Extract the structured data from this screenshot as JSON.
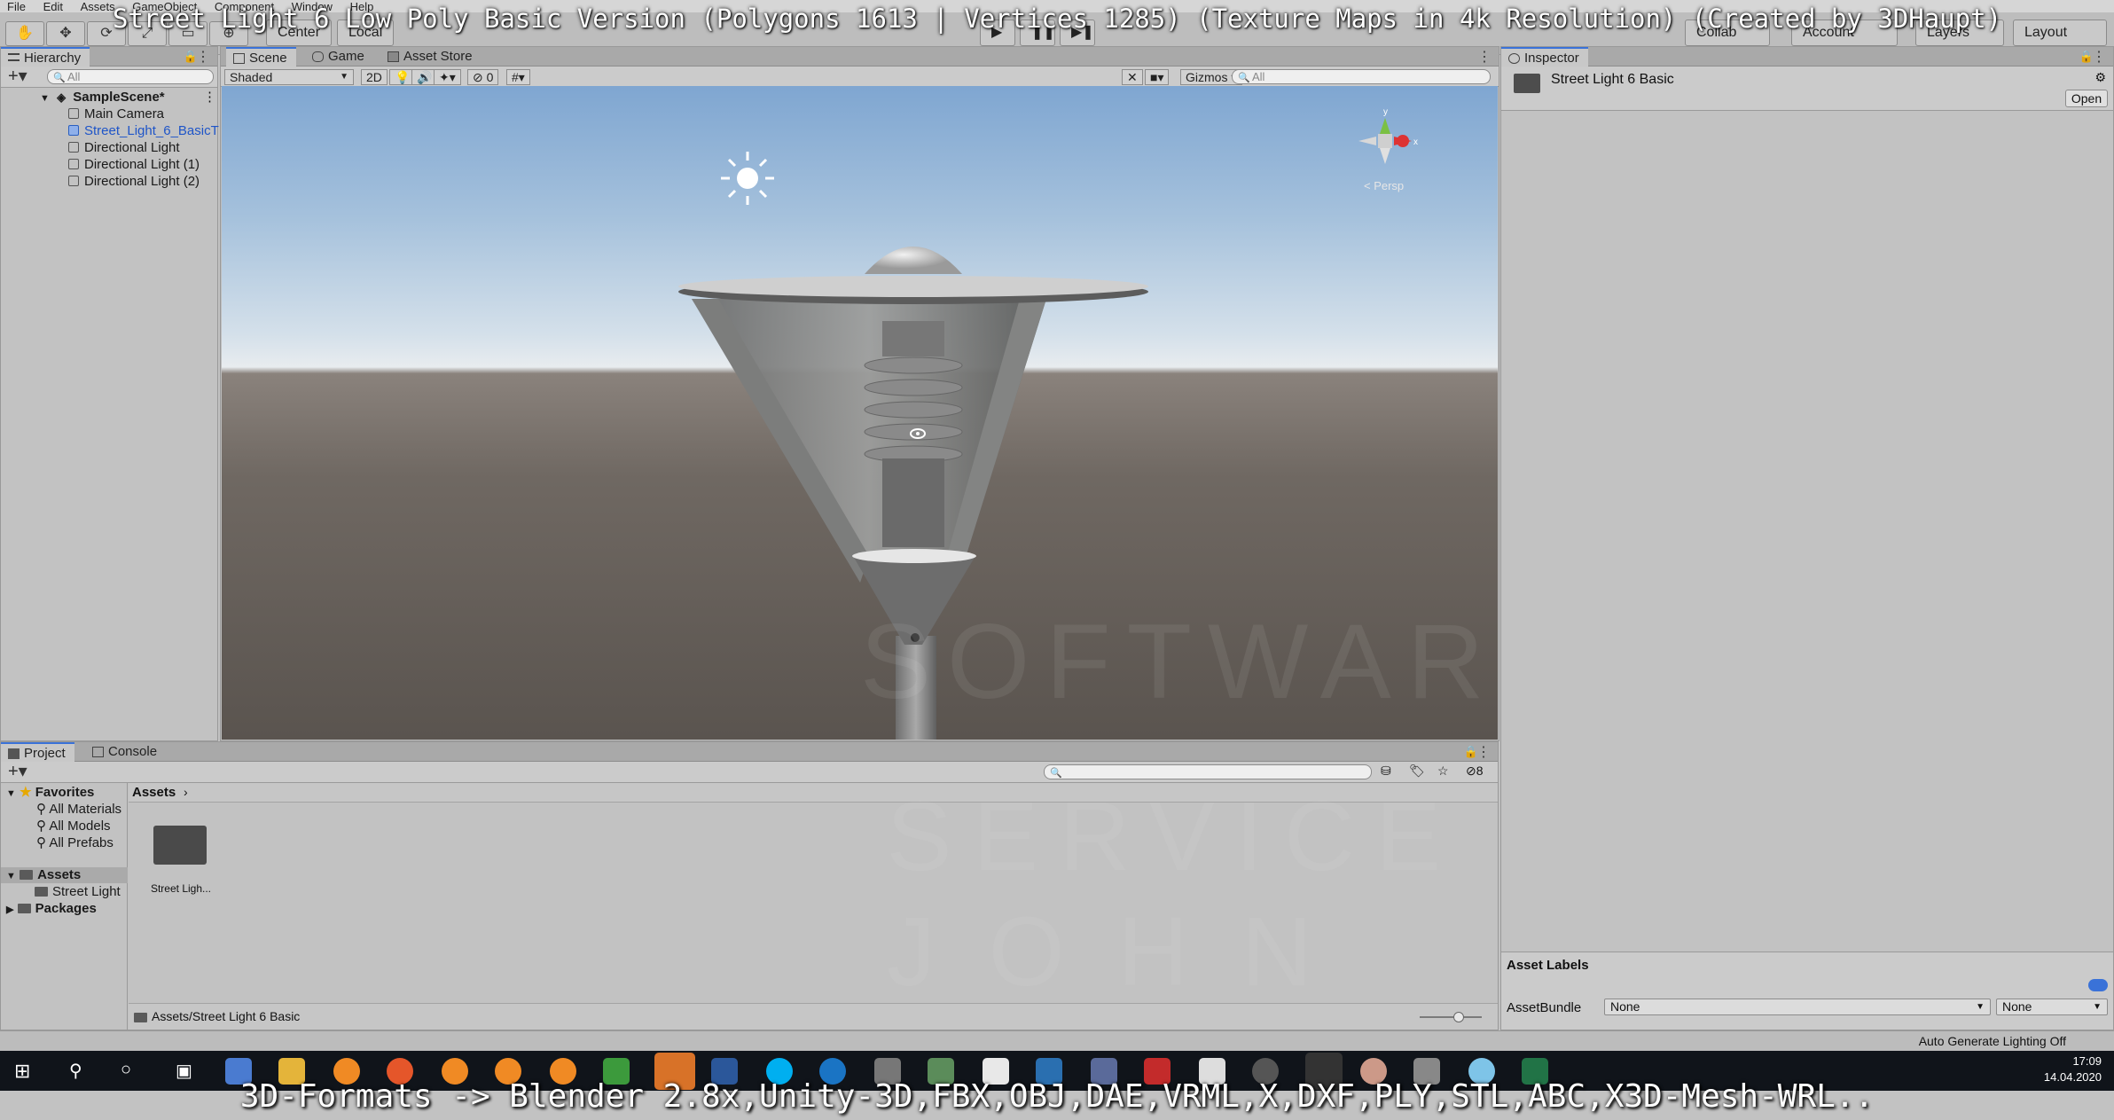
{
  "menu": [
    "File",
    "Edit",
    "Assets",
    "GameObject",
    "Component",
    "Window",
    "Help"
  ],
  "toolbar": {
    "center_label": "Center",
    "local_label": "Local",
    "account_label": "Account",
    "layers_label": "Layers",
    "layout_label": "Layout",
    "cloud_label": "Collab"
  },
  "overlay": {
    "title": "Street Light 6 Low Poly Basic Version (Polygons 1613 | Vertices 1285) (Texture Maps in 4k Resolution) (Created by 3DHaupt)",
    "caption": "3D-Formats -> Blender 2.8x,Unity-3D,FBX,OBJ,DAE,VRML,X,DXF,PLY,STL,ABC,X3D-Mesh-WRL.."
  },
  "hierarchy": {
    "tab": "Hierarchy",
    "search_placeholder": "All",
    "scene": "SampleScene*",
    "items": [
      "Main Camera",
      "Street_Light_6_BasicT",
      "Directional Light",
      "Directional Light (1)",
      "Directional Light (2)"
    ]
  },
  "scene_tabs": {
    "scene": "Scene",
    "game": "Game",
    "asset_store": "Asset Store"
  },
  "scene_bar": {
    "shading": "Shaded",
    "mode_2d": "2D",
    "hidden_count": "0",
    "gizmos": "Gizmos",
    "search_placeholder": "All",
    "persp": "< Persp"
  },
  "watermark": {
    "line1": "SOFTWARE",
    "line2": "SERVICE",
    "line3": "JOHN"
  },
  "inspector": {
    "tab": "Inspector",
    "asset_name": "Street Light 6 Basic",
    "open_label": "Open",
    "asset_labels": "Asset Labels",
    "asset_bundle_label": "AssetBundle",
    "bundle_value": "None",
    "variant_value": "None"
  },
  "project": {
    "tab": "Project",
    "console_tab": "Console",
    "favorites": "Favorites",
    "fav_items": [
      "All Materials",
      "All Models",
      "All Prefabs"
    ],
    "assets": "Assets",
    "asset_children": [
      "Street Light"
    ],
    "packages": "Packages",
    "breadcrumb": "Assets",
    "folder_label": "Street Ligh...",
    "hidden_count": "8",
    "footer_path": "Assets/Street Light 6 Basic"
  },
  "status": {
    "lighting": "Auto Generate Lighting Off"
  },
  "taskbar": {
    "time": "17:09",
    "date": "14.04.2020"
  },
  "colors": {
    "accent": "#3a72d8",
    "selected_text": "#1f55c8"
  }
}
